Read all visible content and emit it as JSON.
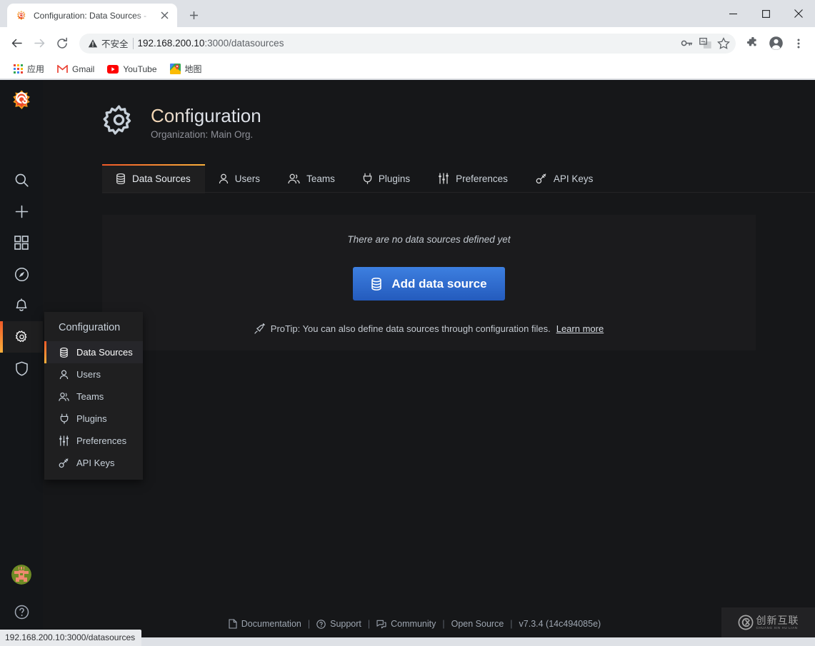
{
  "browser": {
    "tab": {
      "title": "Configuration: Data Sources -",
      "favicon": "grafana-favicon",
      "close_icon": "close-icon"
    },
    "newtab_label": "+",
    "window_controls": {
      "minimize": "minimize-icon",
      "maximize": "maximize-icon",
      "close": "close-icon"
    },
    "toolbar": {
      "back": "back-arrow-icon",
      "forward": "forward-arrow-icon",
      "reload": "reload-icon",
      "security_label": "不安全",
      "security_icon": "warning-triangle-icon",
      "url_host": "192.168.200.10",
      "url_port_path": ":3000/datasources",
      "icons": [
        "key-icon",
        "translate-icon",
        "star-icon",
        "extensions-puzzle-icon",
        "profile-icon",
        "chrome-menu-icon"
      ]
    },
    "bookmarks": [
      {
        "label": "应用",
        "icon": "apps-grid-icon"
      },
      {
        "label": "Gmail",
        "icon": "gmail-icon"
      },
      {
        "label": "YouTube",
        "icon": "youtube-icon"
      },
      {
        "label": "地图",
        "icon": "google-maps-icon"
      }
    ],
    "status_bubble": "192.168.200.10:3000/datasources"
  },
  "sidebar": {
    "logo": "grafana-logo-icon",
    "items": [
      {
        "name": "search",
        "icon": "search-icon",
        "active": false
      },
      {
        "name": "create",
        "icon": "plus-icon",
        "active": false
      },
      {
        "name": "dashboards",
        "icon": "dashboards-grid-icon",
        "active": false
      },
      {
        "name": "explore",
        "icon": "compass-icon",
        "active": false
      },
      {
        "name": "alerting",
        "icon": "bell-icon",
        "active": false
      },
      {
        "name": "configuration",
        "icon": "gear-icon",
        "active": true
      },
      {
        "name": "server-admin",
        "icon": "shield-icon",
        "active": false
      }
    ],
    "avatar": "user-avatar-identicon",
    "help": "help-question-icon"
  },
  "flyout": {
    "title": "Configuration",
    "items": [
      {
        "label": "Data Sources",
        "icon": "database-icon",
        "active": true
      },
      {
        "label": "Users",
        "icon": "user-icon",
        "active": false
      },
      {
        "label": "Teams",
        "icon": "users-icon",
        "active": false
      },
      {
        "label": "Plugins",
        "icon": "plug-icon",
        "active": false
      },
      {
        "label": "Preferences",
        "icon": "sliders-icon",
        "active": false
      },
      {
        "label": "API Keys",
        "icon": "key-skeleton-icon",
        "active": false
      }
    ]
  },
  "header": {
    "icon": "gear-icon",
    "title": "Configuration",
    "subtitle": "Organization: Main Org."
  },
  "tabs": [
    {
      "label": "Data Sources",
      "icon": "database-icon",
      "active": true
    },
    {
      "label": "Users",
      "icon": "user-icon",
      "active": false
    },
    {
      "label": "Teams",
      "icon": "users-icon",
      "active": false
    },
    {
      "label": "Plugins",
      "icon": "plug-icon",
      "active": false
    },
    {
      "label": "Preferences",
      "icon": "sliders-icon",
      "active": false
    },
    {
      "label": "API Keys",
      "icon": "key-skeleton-icon",
      "active": false
    }
  ],
  "main": {
    "empty_message": "There are no data sources defined yet",
    "add_button_label": "Add data source",
    "add_button_icon": "database-icon",
    "protip_icon": "rocket-icon",
    "protip_text": "ProTip: You can also define data sources through configuration files.",
    "protip_link": "Learn more"
  },
  "footer": {
    "links": [
      {
        "label": "Documentation",
        "icon": "document-icon"
      },
      {
        "label": "Support",
        "icon": "question-circle-icon"
      },
      {
        "label": "Community",
        "icon": "comments-icon"
      },
      {
        "label": "Open Source",
        "icon": ""
      }
    ],
    "version": "v7.3.4 (14c494085e)",
    "divider": "|"
  },
  "watermark": {
    "cn": "创新互联",
    "en": "CHUANG XIN HU LIAN",
    "icon": "cx-logo-icon"
  },
  "colors": {
    "accent_start": "#f05a28",
    "accent_end": "#fbb03b",
    "primary_button": "#3d7fe0",
    "app_bg": "#161719",
    "panel_bg": "#1b1b1d",
    "rail_bg": "#141619"
  }
}
